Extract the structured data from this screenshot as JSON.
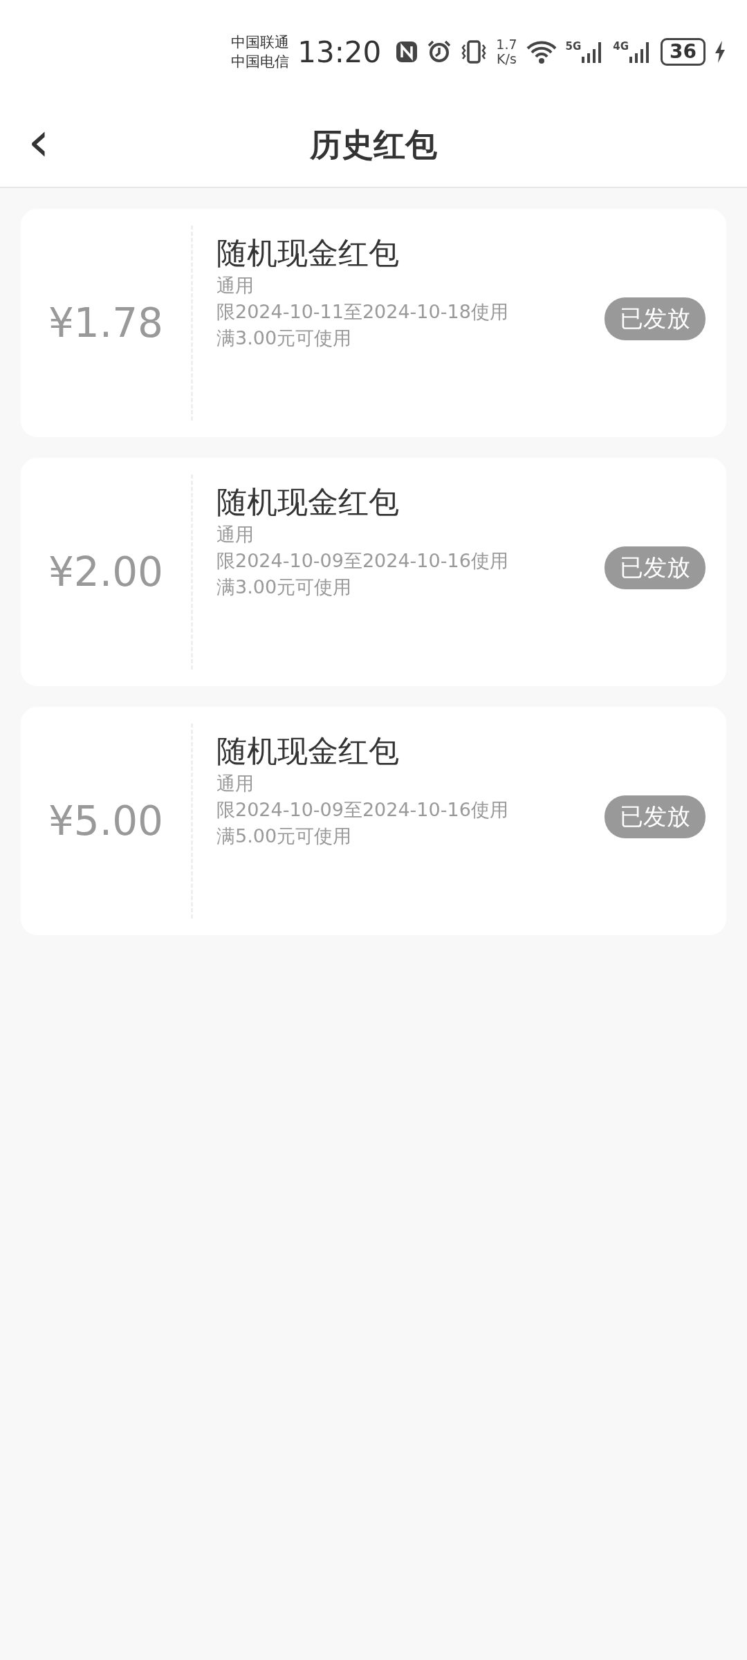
{
  "status_bar": {
    "carriers": [
      "中国联通",
      "中国电信"
    ],
    "time": "13:20",
    "net_speed": [
      "1.7",
      "K/s"
    ],
    "signals": [
      "5G",
      "4G"
    ],
    "battery": "36"
  },
  "header": {
    "back": "‹",
    "title": "历史红包"
  },
  "coupons": [
    {
      "amount": "¥1.78",
      "title": "随机现金红包",
      "scope": "通用",
      "validity": "限2024-10-11至2024-10-18使用",
      "condition": "满3.00元可使用",
      "status": "已发放"
    },
    {
      "amount": "¥2.00",
      "title": "随机现金红包",
      "scope": "通用",
      "validity": "限2024-10-09至2024-10-16使用",
      "condition": "满3.00元可使用",
      "status": "已发放"
    },
    {
      "amount": "¥5.00",
      "title": "随机现金红包",
      "scope": "通用",
      "validity": "限2024-10-09至2024-10-16使用",
      "condition": "满5.00元可使用",
      "status": "已发放"
    }
  ]
}
